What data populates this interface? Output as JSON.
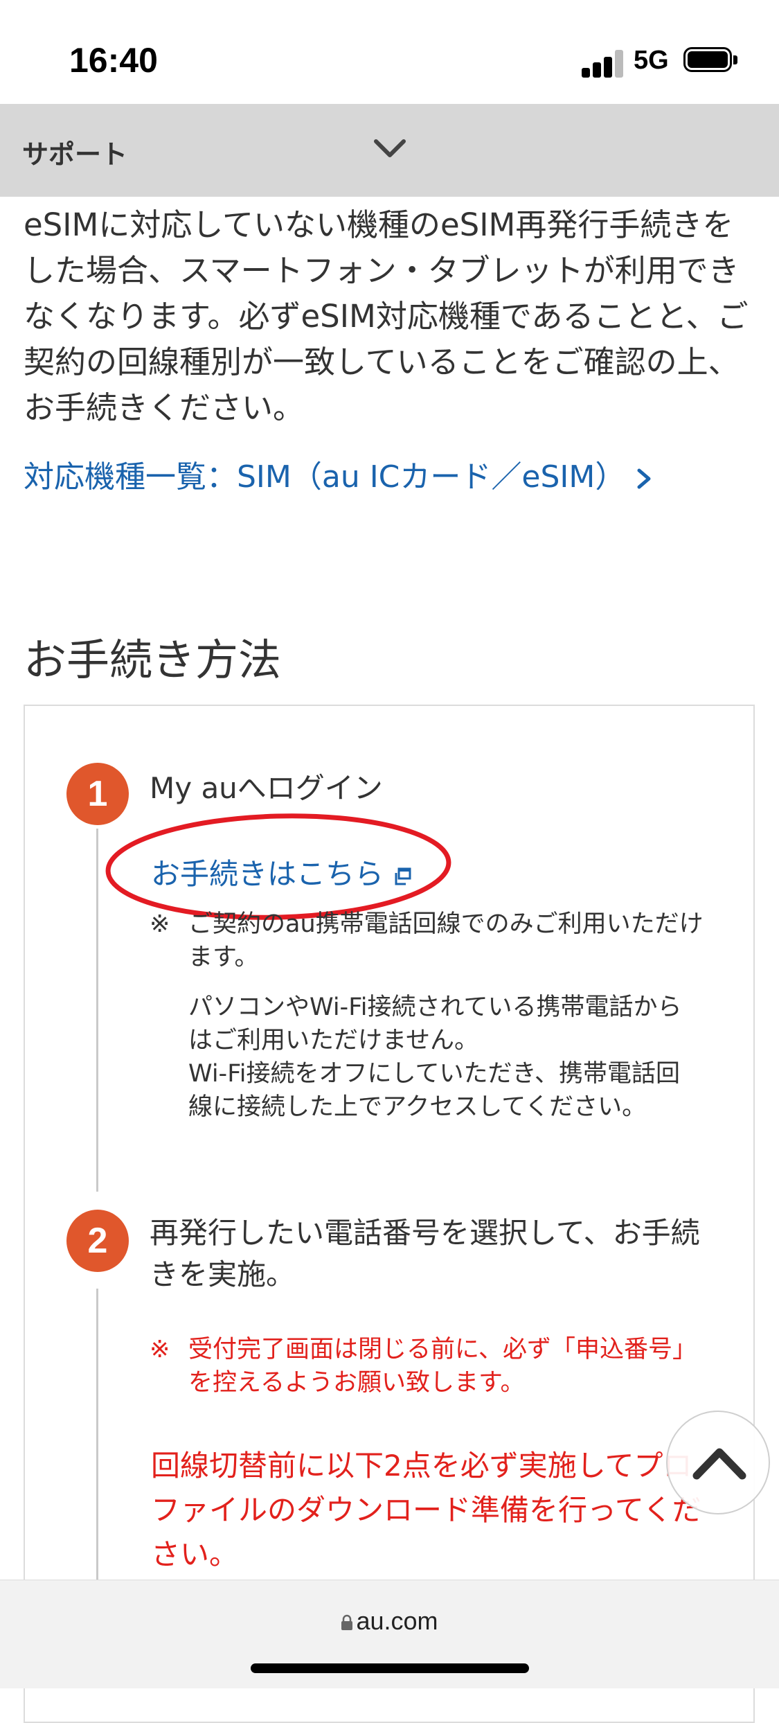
{
  "status_bar": {
    "time": "16:40",
    "network": "5G"
  },
  "header": {
    "support_label": "サポート",
    "chevron_icon": "chevron-down-icon"
  },
  "intro_text": "eSIMに対応していない機種のeSIM再発行手続きをした場合、スマートフォン・タブレットが利用できなくなります。必ずeSIM対応機種であることと、ご契約の回線種別が一致していることをご確認の上、お手続きください。",
  "models_link": "対応機種一覧：SIM（au ICカード／eSIM）",
  "section_title": "お手続き方法",
  "steps": [
    {
      "number": "1",
      "title": "My auへログイン",
      "link": "お手続きはこちら",
      "note_mark": "※",
      "note_line1": "ご契約のau携帯電話回線でのみご利用いただけます。",
      "note_line2": "パソコンやWi-Fi接続されている携帯電話からはご利用いただけません。",
      "note_line3": "Wi-Fi接続をオフにしていただき、携帯電話回線に接続した上でアクセスしてください。"
    },
    {
      "number": "2",
      "title": "再発行したい電話番号を選択して、お手続きを実施。",
      "note_mark": "※",
      "note": "受付完了画面は閉じる前に、必ず「申込番号」を控えるようお願い致します。",
      "warning": "回線切替前に以下2点を必ず実施してプロファイルのダウンロード準備を行ってください。"
    }
  ],
  "url_bar": {
    "domain": "au.com"
  },
  "colors": {
    "accent_link": "#1a63ad",
    "step_circle": "#e0572c",
    "warning": "#e2211c",
    "highlight": "#e31b23"
  }
}
